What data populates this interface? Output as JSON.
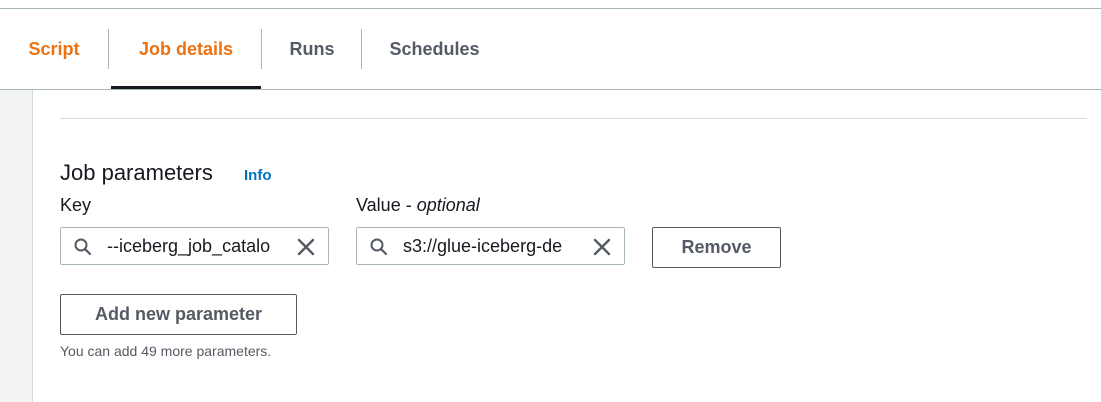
{
  "tabs": [
    {
      "label": "Script"
    },
    {
      "label": "Job details"
    },
    {
      "label": "Runs"
    },
    {
      "label": "Schedules"
    }
  ],
  "job_parameters": {
    "heading": "Job parameters",
    "info_link": "Info",
    "key_label": "Key",
    "value_label": "Value - ",
    "value_label_optional": "optional",
    "key_value": "--iceberg_job_catalo",
    "value_value": "s3://glue-iceberg-de",
    "remove_label": "Remove",
    "add_label": "Add new parameter",
    "hint": "You can add 49 more parameters."
  },
  "colors": {
    "accent_orange": "#ec7211",
    "link_blue": "#0073bb",
    "text_dark": "#16191f",
    "text_muted": "#545b64",
    "border": "#aab7b8"
  }
}
